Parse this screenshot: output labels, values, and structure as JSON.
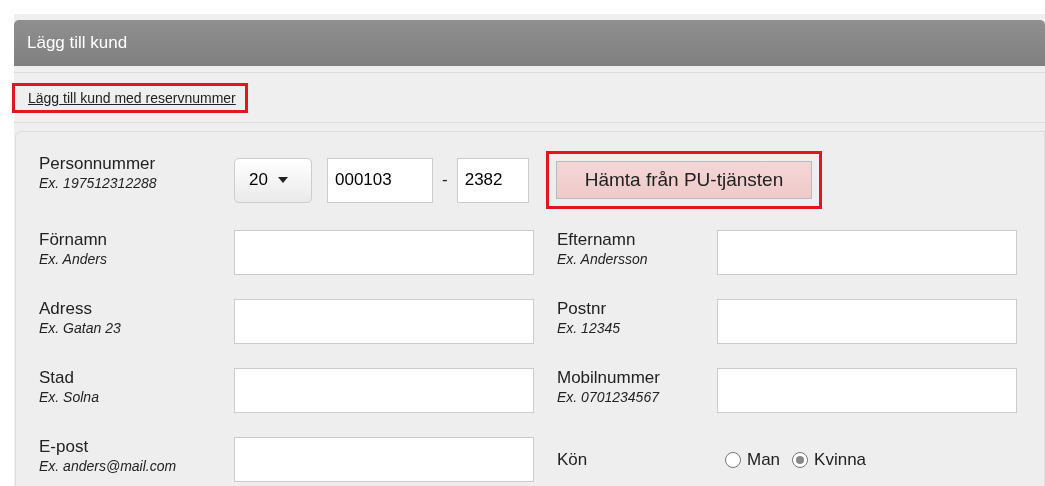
{
  "header": {
    "title": "Lägg till kund"
  },
  "link": {
    "text": "Lägg till kund med reservnummer",
    "highlighted": true
  },
  "personnummer": {
    "label": "Personnummer",
    "example": "Ex. 197512312288",
    "century": "20",
    "date_value": "000103",
    "separator": "-",
    "suffix_value": "2382",
    "fetch_button": {
      "label": "Hämta från PU-tjänsten",
      "highlighted": true
    }
  },
  "rows": [
    [
      {
        "kind": "text",
        "label": "Förnamn",
        "example": "Ex. Anders"
      },
      {
        "kind": "text",
        "label": "Efternamn",
        "example": "Ex. Andersson"
      }
    ],
    [
      {
        "kind": "text",
        "label": "Adress",
        "example": "Ex. Gatan 23"
      },
      {
        "kind": "text",
        "label": "Postnr",
        "example": "Ex. 12345"
      }
    ],
    [
      {
        "kind": "text",
        "label": "Stad",
        "example": "Ex. Solna"
      },
      {
        "kind": "text",
        "label": "Mobilnummer",
        "example": "Ex. 0701234567"
      }
    ],
    [
      {
        "kind": "text",
        "label": "E-post",
        "example": "Ex. anders@mail.com"
      },
      {
        "kind": "radio",
        "label": "Kön",
        "options": [
          {
            "label": "Man",
            "selected": false
          },
          {
            "label": "Kvinna",
            "selected": true
          }
        ]
      }
    ]
  ]
}
